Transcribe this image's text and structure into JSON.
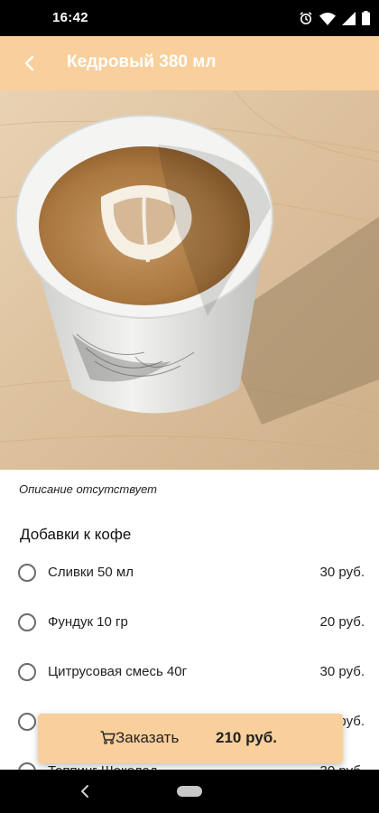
{
  "status_bar": {
    "time": "16:42",
    "icons": [
      "alarm-icon",
      "wifi-icon",
      "signal-icon",
      "battery-icon"
    ]
  },
  "app_bar": {
    "title": "Кедровый 380 мл",
    "back_icon": "chevron-left-icon"
  },
  "product": {
    "image": "coffee-cup-latte-art",
    "description": "Описание отсутствует"
  },
  "addons": {
    "title": "Добавки к кофе",
    "items": [
      {
        "name": "Сливки 50 мл",
        "price": "30 руб.",
        "selected": false
      },
      {
        "name": "Фундук 10 гр",
        "price": "20 руб.",
        "selected": false
      },
      {
        "name": "Цитрусовая смесь 40г",
        "price": "30 руб.",
        "selected": false
      },
      {
        "name": "",
        "price": "руб.",
        "selected": false
      },
      {
        "name": "Топпинг Шоколад",
        "price": "30 руб.",
        "selected": false
      }
    ]
  },
  "order": {
    "label": "Заказать",
    "total": "210 руб.",
    "icon": "cart-icon"
  },
  "colors": {
    "accent": "#f9cf9c",
    "status_bar": "#000000",
    "nav_bar": "#000000"
  }
}
